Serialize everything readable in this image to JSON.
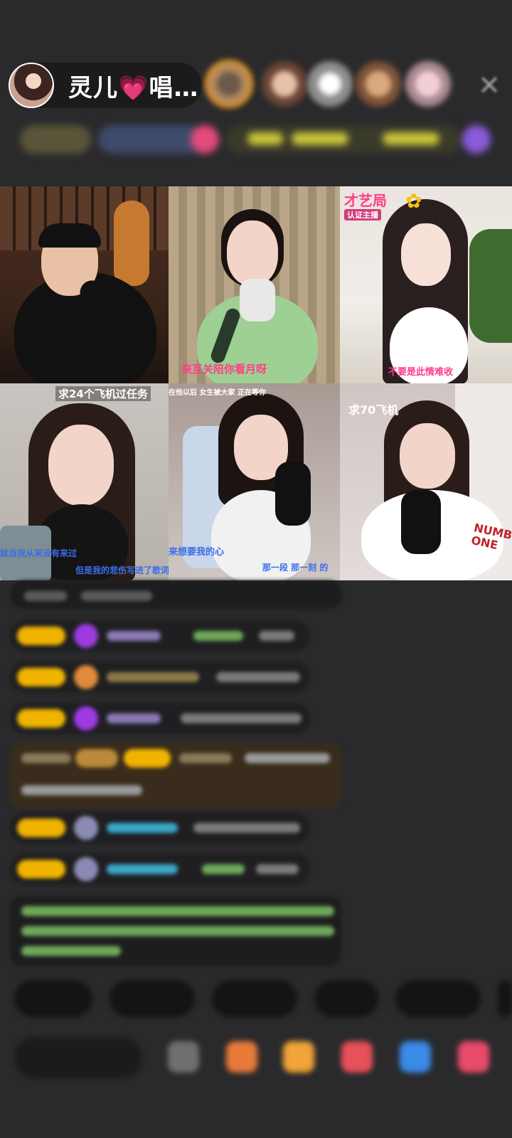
{
  "header": {
    "host_name": "灵儿",
    "host_heart": "💗",
    "host_suffix": "唱…",
    "close_symbol": "✕"
  },
  "tiles": [
    {
      "id": "tile-1",
      "caption": ""
    },
    {
      "id": "tile-2",
      "caption": "来互关陪你看月呀"
    },
    {
      "id": "tile-3",
      "title": "才艺局",
      "sub": "认证主播",
      "caption": "不要是此情难收"
    },
    {
      "id": "tile-4",
      "title": "求24个飞机过任务",
      "caption": "就当我从来没有来过",
      "caption2": "但是我的悲伤写进了歌词"
    },
    {
      "id": "tile-5",
      "title": "在他以后 女生被大家 正在等你",
      "caption": "来想要我的心",
      "caption2": "那一段 那一刻 的"
    },
    {
      "id": "tile-6",
      "title": "求70飞机",
      "shirt": "NUMB ONE"
    }
  ],
  "colors": {
    "accent": "#ff3da6",
    "badge": "#f0b400",
    "background": "#2a2a2c"
  }
}
